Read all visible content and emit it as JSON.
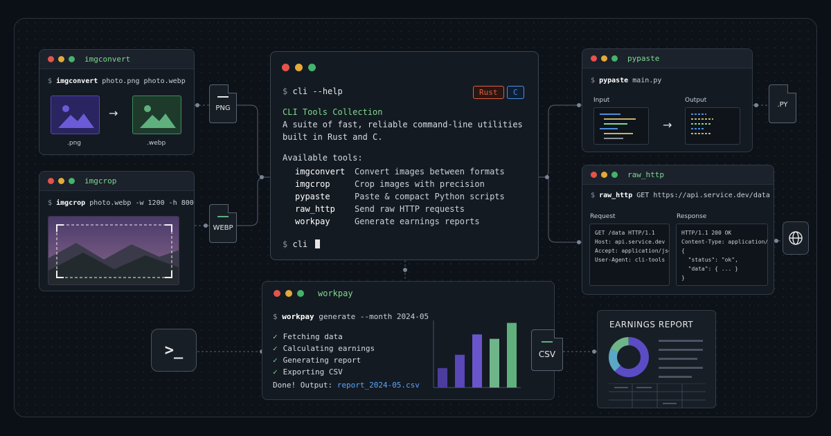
{
  "imgconvert": {
    "title": "imgconvert",
    "prompt": "$",
    "command": "imgconvert",
    "args": " photo.png photo.webp",
    "from_label": ".png",
    "to_label": ".webp",
    "arrow": "→"
  },
  "imgcrop": {
    "title": "imgcrop",
    "prompt": "$",
    "command": "imgcrop",
    "args": " photo.webp -w 1200 -h 800"
  },
  "file_png": {
    "label": "PNG"
  },
  "file_webp": {
    "label": "WEBP"
  },
  "file_py": {
    "label": ".PY"
  },
  "file_csv": {
    "label": "CSV"
  },
  "main": {
    "prompt": "$",
    "help_cmd": "cli --help",
    "badge_rust": "Rust",
    "badge_c": "C",
    "heading": "CLI Tools Collection",
    "desc1": "A suite of fast, reliable command-line utilities",
    "desc2": "built in Rust and C.",
    "available": "Available tools:",
    "tools": [
      {
        "name": "imgconvert",
        "desc": "Convert images between formats"
      },
      {
        "name": "imgcrop",
        "desc": "Crop images with precision"
      },
      {
        "name": "pypaste",
        "desc": "Paste & compact Python scripts"
      },
      {
        "name": "raw_http",
        "desc": "Send raw HTTP requests"
      },
      {
        "name": "workpay",
        "desc": "Generate earnings reports"
      }
    ],
    "final_cmd": "cli"
  },
  "pypaste": {
    "title": "pypaste",
    "prompt": "$",
    "command": "pypaste",
    "args": " main.py",
    "input_label": "Input",
    "output_label": "Output",
    "arrow": "→"
  },
  "raw_http": {
    "title": "raw_http",
    "prompt": "$",
    "command": "raw_http",
    "args": " GET https://api.service.dev/data",
    "request_label": "Request",
    "response_label": "Response",
    "request_lines": "GET /data HTTP/1.1\nHost: api.service.dev\nAccept: application/json\nUser-Agent: cli-tools",
    "response_lines": "HTTP/1.1 200 OK\nContent-Type: application/json\n{\n  \"status\": \"ok\",\n  \"data\": { ... }\n}"
  },
  "workpay": {
    "title": "workpay",
    "prompt": "$",
    "command": "workpay",
    "args": " generate --month 2024-05",
    "steps": [
      "Fetching data",
      "Calculating earnings",
      "Generating report",
      "Exporting CSV"
    ],
    "check": "✓",
    "done_text": "Done! Output: ",
    "output_file": "report_2024-05.csv",
    "bar_levels": [
      0.22,
      0.37,
      0.6,
      0.55,
      0.73
    ],
    "bar_colors": [
      "#4b3d9e",
      "#5a47b8",
      "#6a56cc",
      "#6fb58a",
      "#5fb07d"
    ]
  },
  "terminal_icon": {
    "glyph": ">_"
  },
  "report": {
    "title": "EARNINGS REPORT",
    "donut_colors": [
      "#5b4bc4",
      "#5aa7c6",
      "#6fb58a"
    ]
  },
  "colors": {
    "accent_green": "#7fd98f",
    "accent_purple": "#5b4bc4",
    "rust": "#e0603e",
    "c": "#4d8fe0",
    "link": "#58a6ff"
  }
}
